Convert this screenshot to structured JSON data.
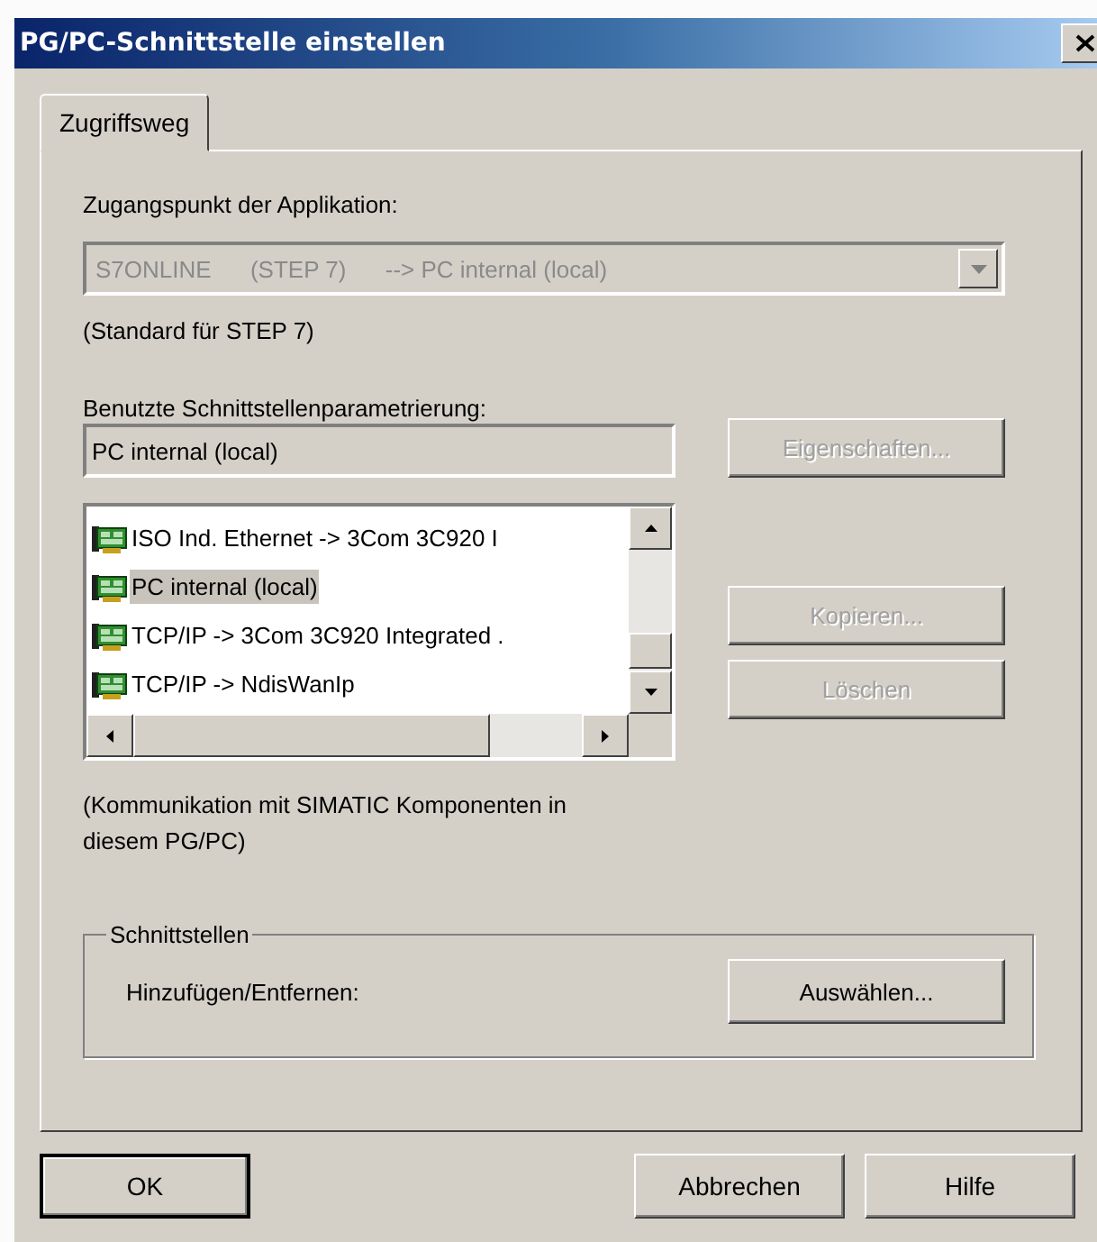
{
  "window": {
    "title": "PG/PC-Schnittstelle einstellen"
  },
  "tabs": [
    {
      "label": "Zugriffsweg",
      "selected": true
    }
  ],
  "access_point": {
    "label": "Zugangspunkt der Applikation:",
    "value": "S7ONLINE      (STEP 7)      --> PC internal (local)",
    "disabled": true,
    "note": "(Standard für STEP 7)"
  },
  "parameterization": {
    "label": "Benutzte Schnittstellenparametrierung:",
    "value": "PC internal (local)",
    "items": [
      {
        "label": "ISO Ind. Ethernet -> 3Com 3C920 I",
        "selected": false
      },
      {
        "label": "PC internal (local)",
        "selected": true
      },
      {
        "label": "TCP/IP -> 3Com 3C920 Integrated .",
        "selected": false
      },
      {
        "label": "TCP/IP -> NdisWanIp",
        "selected": false
      }
    ],
    "note": "(Kommunikation mit SIMATIC Komponenten in diesem PG/PC)"
  },
  "side_buttons": [
    {
      "label": "Eigenschaften...",
      "disabled": true
    },
    {
      "label": "Kopieren...",
      "disabled": true
    },
    {
      "label": "Löschen",
      "disabled": true
    }
  ],
  "interfaces": {
    "title": "Schnittstellen",
    "label": "Hinzufügen/Entfernen:",
    "button": "Auswählen..."
  },
  "buttons": [
    {
      "label": "OK",
      "default": true
    },
    {
      "label": "Abbrechen",
      "default": false
    },
    {
      "label": "Hilfe",
      "default": false
    }
  ]
}
